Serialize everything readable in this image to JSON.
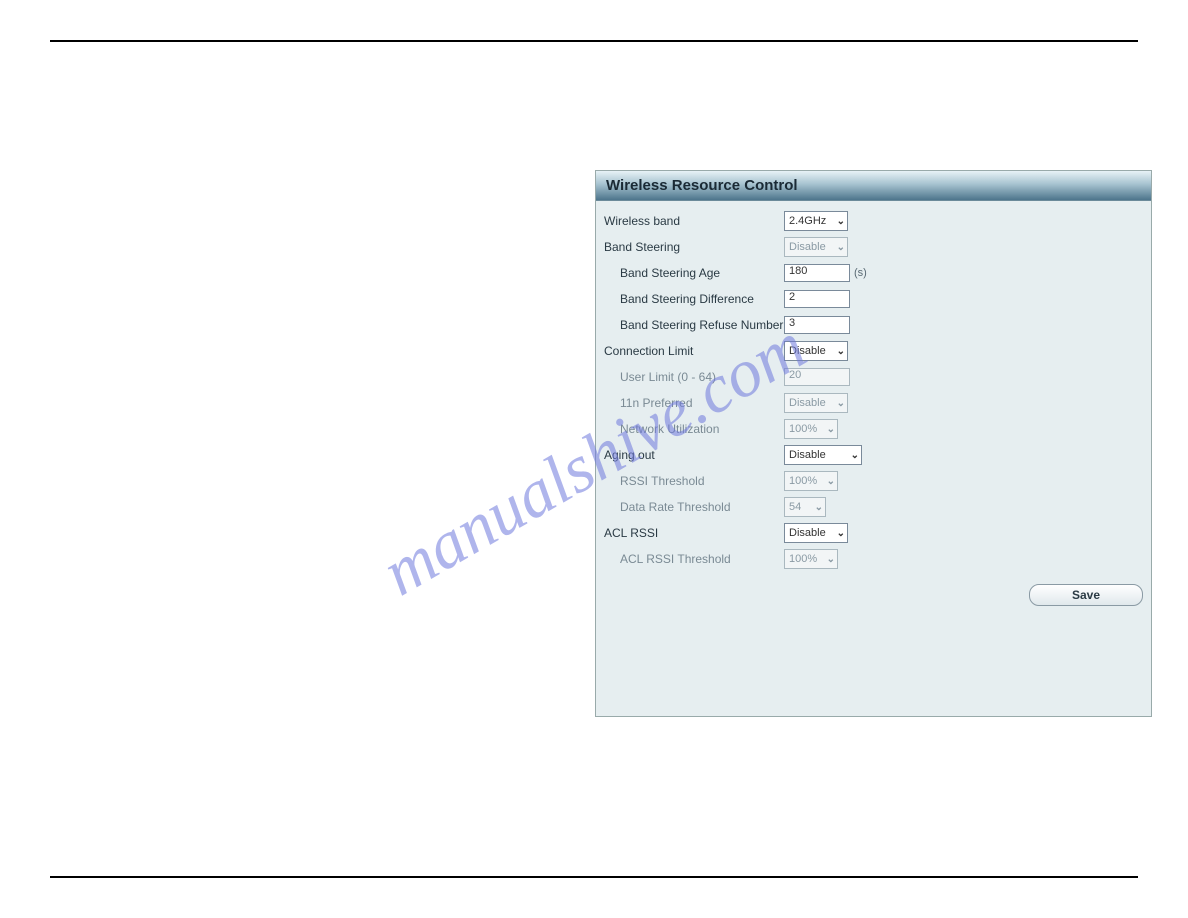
{
  "watermark": "manualshive.com",
  "panel": {
    "title": "Wireless Resource Control",
    "fields": {
      "wireless_band": {
        "label": "Wireless band",
        "value": "2.4GHz"
      },
      "band_steering": {
        "label": "Band Steering",
        "value": "Disable"
      },
      "band_steering_age": {
        "label": "Band Steering Age",
        "value": "180",
        "unit": "(s)"
      },
      "band_steering_diff": {
        "label": "Band Steering Difference",
        "value": "2"
      },
      "band_steering_refuse": {
        "label": "Band Steering Refuse Number",
        "value": "3"
      },
      "connection_limit": {
        "label": "Connection Limit",
        "value": "Disable"
      },
      "user_limit": {
        "label": "User Limit (0 - 64)",
        "value": "20"
      },
      "n_preferred": {
        "label": "11n Preferred",
        "value": "Disable"
      },
      "network_util": {
        "label": "Network Utilization",
        "value": "100%"
      },
      "aging_out": {
        "label": "Aging out",
        "value": "Disable"
      },
      "rssi_threshold": {
        "label": "RSSI Threshold",
        "value": "100%"
      },
      "data_rate_threshold": {
        "label": "Data Rate Threshold",
        "value": "54"
      },
      "acl_rssi": {
        "label": "ACL RSSI",
        "value": "Disable"
      },
      "acl_rssi_threshold": {
        "label": "ACL RSSI Threshold",
        "value": "100%"
      }
    },
    "save_button": "Save"
  }
}
